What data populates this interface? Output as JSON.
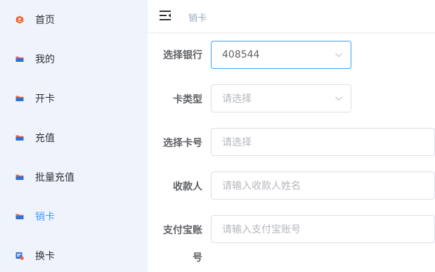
{
  "sidebar": {
    "items": [
      {
        "label": "首页",
        "icon": "home-icon",
        "active": false
      },
      {
        "label": "我的",
        "icon": "folder-icon",
        "active": false
      },
      {
        "label": "开卡",
        "icon": "folder-icon",
        "active": false
      },
      {
        "label": "充值",
        "icon": "folder-icon",
        "active": false
      },
      {
        "label": "批量充值",
        "icon": "folder-icon",
        "active": false
      },
      {
        "label": "销卡",
        "icon": "folder-icon",
        "active": true
      },
      {
        "label": "换卡",
        "icon": "card-swap-icon",
        "active": false
      }
    ]
  },
  "header": {
    "toggle_icon": "menu-fold-icon",
    "breadcrumb": "销卡"
  },
  "form": {
    "bank": {
      "label": "选择银行",
      "value": "408544"
    },
    "card_type": {
      "label": "卡类型",
      "placeholder": "请选择"
    },
    "card_no": {
      "label": "选择卡号",
      "placeholder": "请选择"
    },
    "payee": {
      "label": "收款人",
      "placeholder": "请输入收款人姓名"
    },
    "alipay": {
      "label_line1": "支付宝账",
      "label_line2": "号",
      "placeholder": "请输入支付宝账号"
    }
  },
  "colors": {
    "accent": "#409eff",
    "sidebar_bg": "#eef3fc",
    "icon_orange": "#f0643c",
    "icon_blue": "#2f6fd6"
  }
}
